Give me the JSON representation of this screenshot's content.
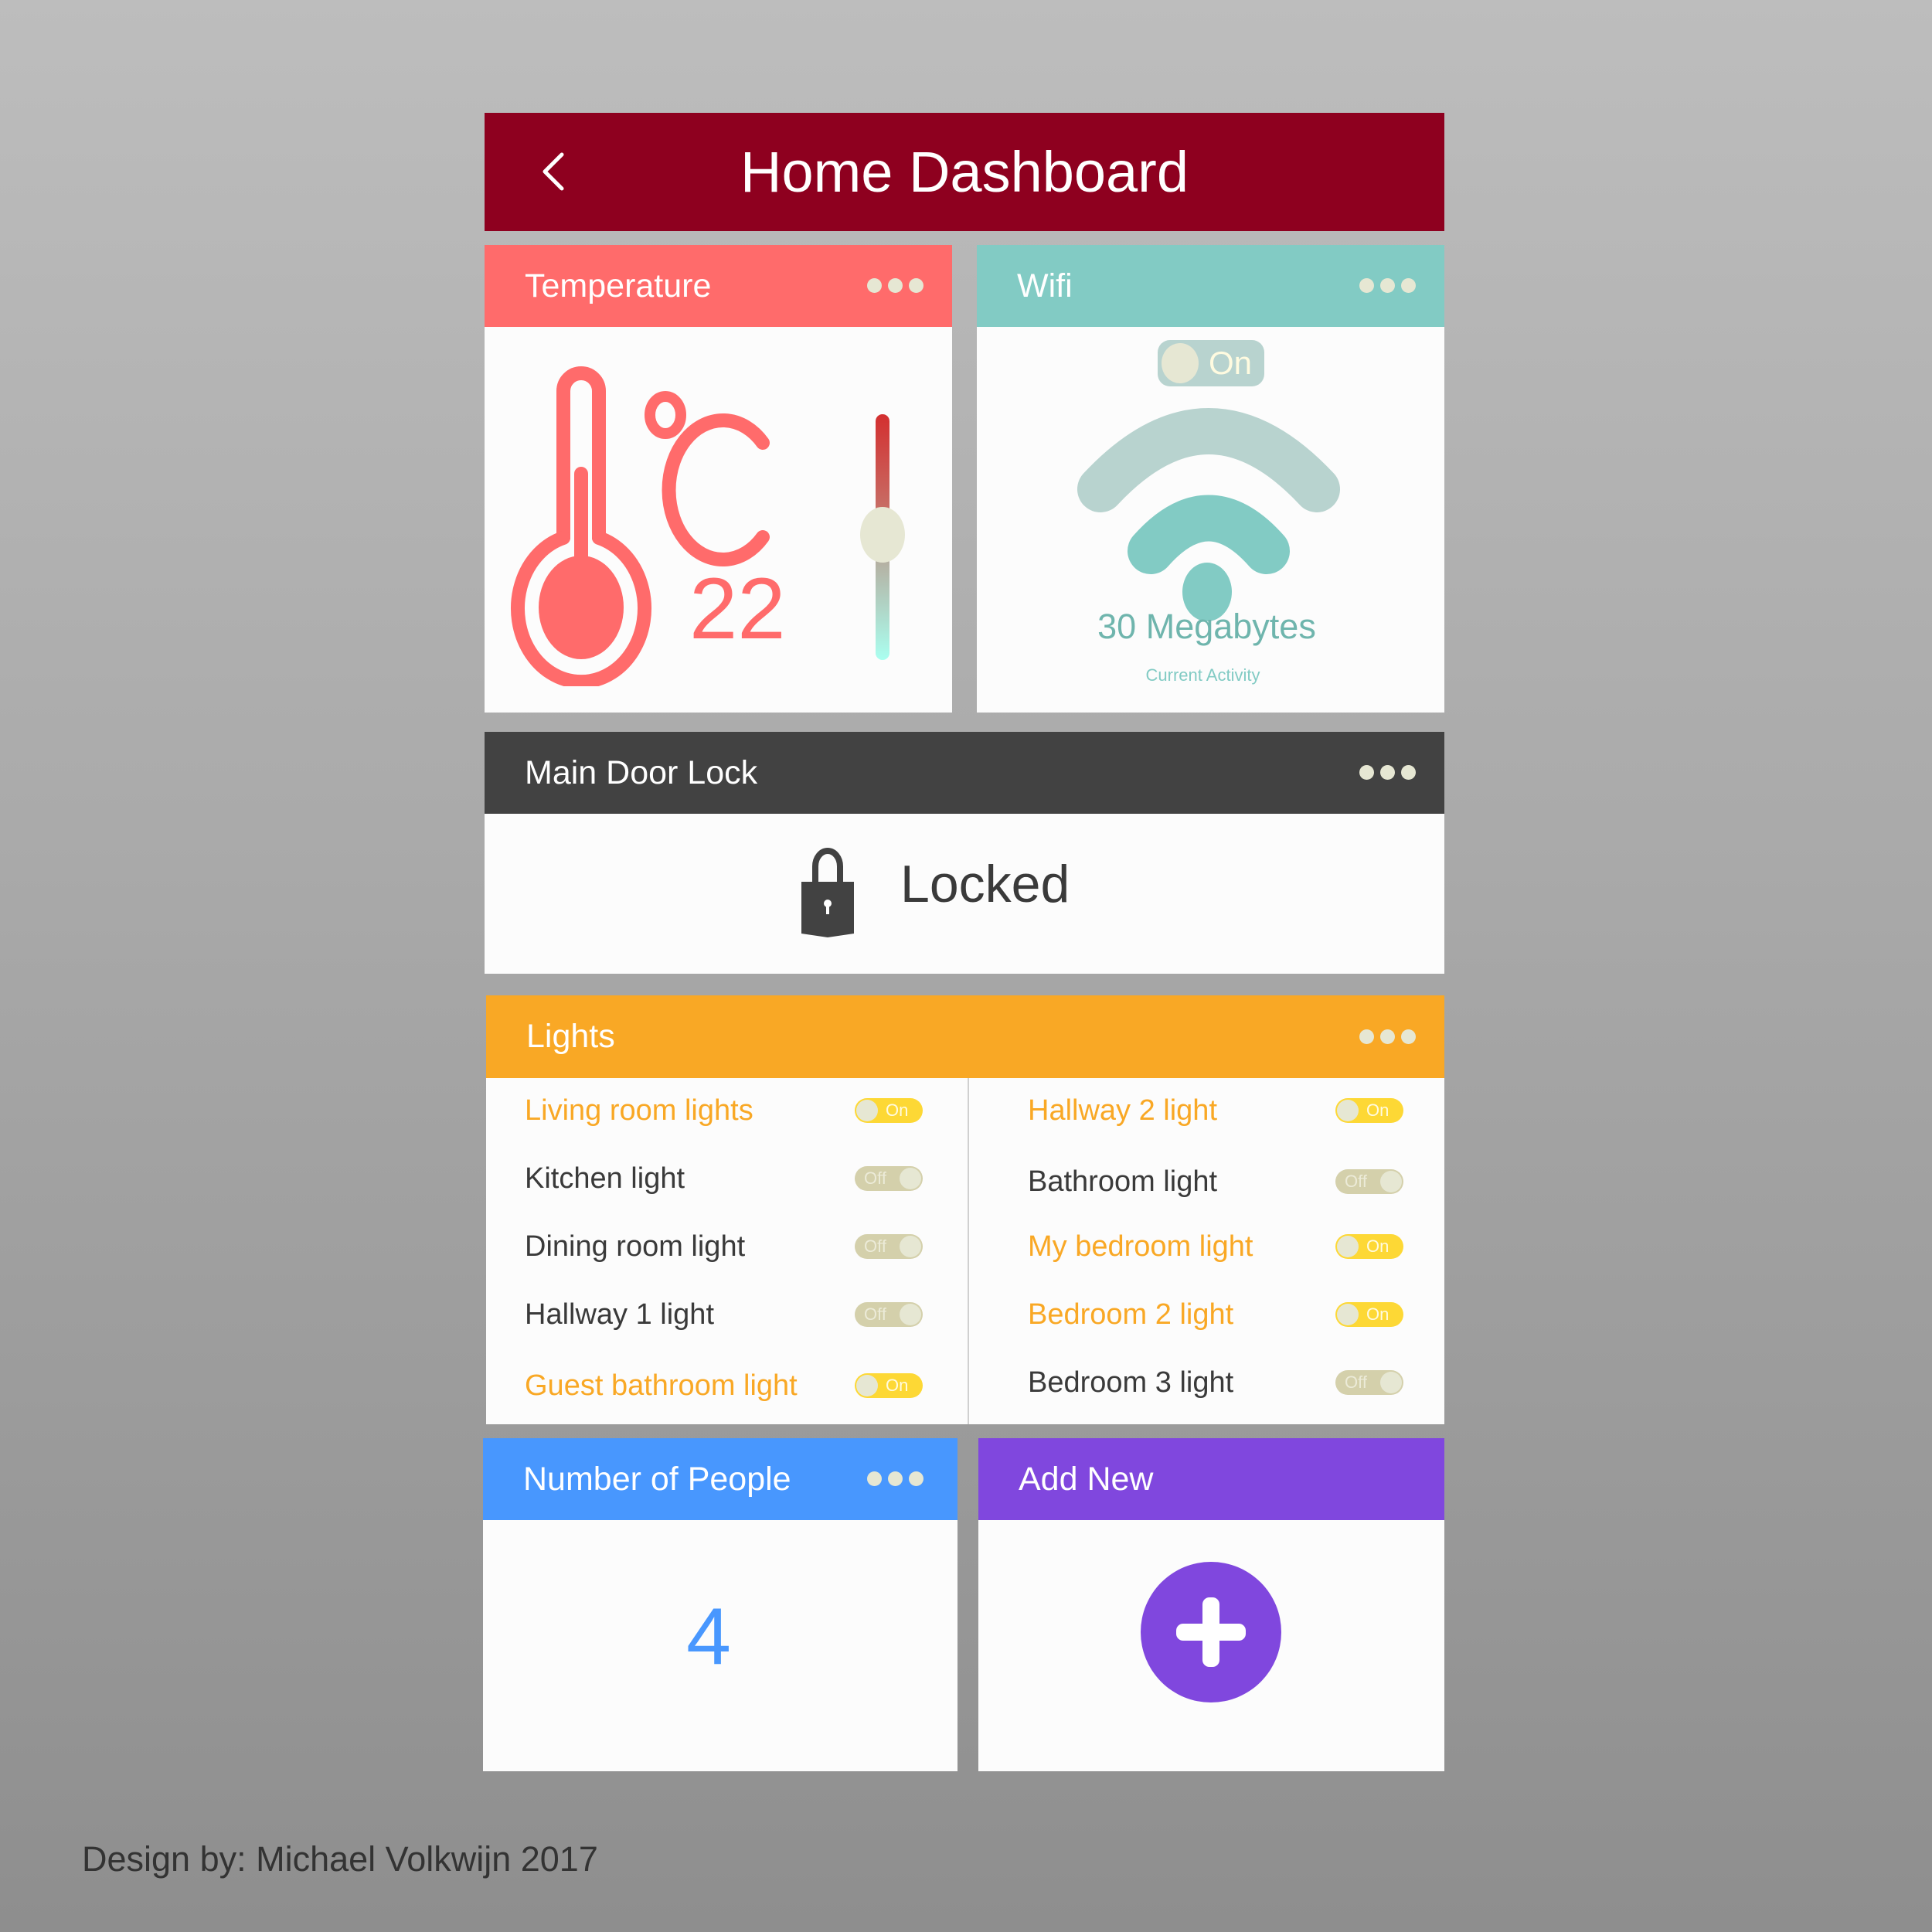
{
  "header": {
    "title": "Home Dashboard",
    "back_icon": "chevron-left-icon"
  },
  "temperature": {
    "title": "Temperature",
    "menu_icon": "more-dots-icon",
    "unit": "°C",
    "value": "22",
    "slider_level": 0.5,
    "colors": {
      "accent": "#ff6b6b"
    }
  },
  "wifi": {
    "title": "Wifi",
    "menu_icon": "more-dots-icon",
    "toggle_label": "On",
    "speed": "30 Megabytes",
    "caption": "Current Activity",
    "colors": {
      "accent": "#82cbc4"
    }
  },
  "door": {
    "title": "Main Door Lock",
    "menu_icon": "more-dots-icon",
    "status": "Locked",
    "colors": {
      "accent": "#424242"
    }
  },
  "lights": {
    "title": "Lights",
    "menu_icon": "more-dots-icon",
    "on_label": "On",
    "off_label": "Off",
    "left": [
      {
        "name": "Living room lights",
        "state": "on"
      },
      {
        "name": "Kitchen light",
        "state": "off"
      },
      {
        "name": "Dining room light",
        "state": "off"
      },
      {
        "name": "Hallway 1 light",
        "state": "off"
      },
      {
        "name": "Guest bathroom light",
        "state": "on"
      }
    ],
    "right": [
      {
        "name": "Hallway 2 light",
        "state": "on"
      },
      {
        "name": "Bathroom light",
        "state": "off"
      },
      {
        "name": "My bedroom light",
        "state": "on"
      },
      {
        "name": "Bedroom 2 light",
        "state": "on"
      },
      {
        "name": "Bedroom 3 light",
        "state": "off"
      }
    ],
    "colors": {
      "accent": "#f9a825",
      "toggle_on": "#fdd835",
      "toggle_off": "#d4d0ab"
    }
  },
  "people": {
    "title": "Number of People",
    "menu_icon": "more-dots-icon",
    "count": "4",
    "colors": {
      "accent": "#4897fe"
    }
  },
  "add_new": {
    "title": "Add New",
    "button_icon": "plus-icon",
    "colors": {
      "accent": "#8047de"
    }
  },
  "footer": {
    "credit": "Design by: Michael Volkwijn 2017"
  }
}
